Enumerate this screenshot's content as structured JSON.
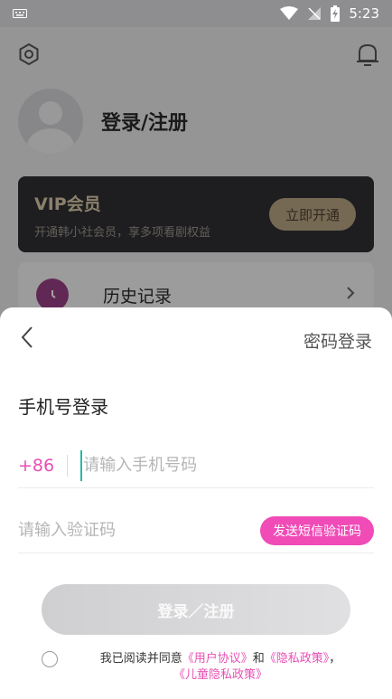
{
  "status_bar": {
    "time": "5:23"
  },
  "background": {
    "profile": {
      "name": "登录/注册"
    },
    "vip": {
      "title": "VIP会员",
      "desc": "开通韩小社会员，享多项看剧权益",
      "button": "立即开通"
    },
    "history": {
      "label": "历史记录"
    }
  },
  "sheet": {
    "password_login": "密码登录",
    "title": "手机号登录",
    "country_code": "+86",
    "phone_placeholder": "请输入手机号码",
    "code_placeholder": "请输入验证码",
    "send_code": "发送短信验证码",
    "submit": "登录／注册",
    "agreement": {
      "prefix": "我已阅读并同意",
      "user_agreement": "《用户协议》",
      "and": "和",
      "privacy_policy": "《隐私政策》",
      "comma": "，",
      "child_privacy": "《儿童隐私政策》"
    }
  },
  "colors": {
    "accent": "#f04bb7",
    "link": "#e84fb4"
  }
}
